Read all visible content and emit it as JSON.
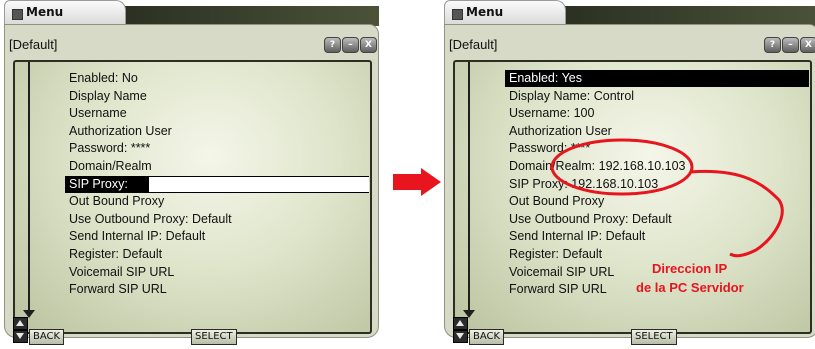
{
  "colors": {
    "accent_red": "#e8141e",
    "selection": "#000000"
  },
  "left": {
    "tab_label": "Menu",
    "header": "[Default]",
    "controls": [
      "?",
      "–",
      "X"
    ],
    "items": [
      "Enabled: No",
      "Display Name",
      "Username",
      "Authorization User",
      "Password: ****",
      "Domain/Realm",
      "SIP Proxy:",
      "Out Bound Proxy",
      "Use Outbound Proxy: Default",
      "Send Internal IP: Default",
      "Register: Default",
      "Voicemail SIP URL",
      "Forward SIP URL"
    ],
    "selected_index": 6,
    "back_label": "BACK",
    "select_label": "SELECT",
    "sip_proxy_input_value": ""
  },
  "right": {
    "tab_label": "Menu",
    "header": "[Default]",
    "controls": [
      "?",
      "–",
      "X"
    ],
    "items": [
      "Enabled: Yes",
      "Display Name: Control",
      "Username: 100",
      "Authorization User",
      "Password: ****",
      "Domain/Realm: 192.168.10.103",
      "SIP Proxy: 192.168.10.103",
      "Out Bound Proxy",
      "Use Outbound Proxy: Default",
      "Send Internal IP: Default",
      "Register: Default",
      "Voicemail SIP URL",
      "Forward SIP URL"
    ],
    "selected_index": 0,
    "back_label": "BACK",
    "select_label": "SELECT"
  },
  "annotation": {
    "line1": "Direccion IP",
    "line2": "de la PC Servidor"
  },
  "icons": {
    "arrow": "right-arrow-icon",
    "window": "menu-window-icon"
  }
}
